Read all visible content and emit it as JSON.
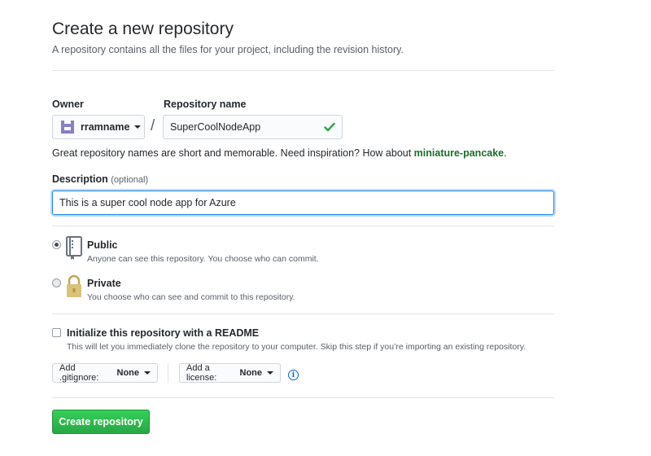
{
  "header": {
    "title": "Create a new repository",
    "subtitle": "A repository contains all the files for your project, including the revision history."
  },
  "owner": {
    "label": "Owner",
    "value": "rramname"
  },
  "repository": {
    "label": "Repository name",
    "value": "SuperCoolNodeApp",
    "separator": "/"
  },
  "hint": {
    "text": "Great repository names are short and memorable. Need inspiration? How about ",
    "suggestion": "miniature-pancake",
    "end": "."
  },
  "description": {
    "label": "Description",
    "optional": "(optional)",
    "value": "This is a super cool node app for Azure"
  },
  "visibility": {
    "public": {
      "title": "Public",
      "desc": "Anyone can see this repository. You choose who can commit.",
      "checked": true
    },
    "private": {
      "title": "Private",
      "desc": "You choose who can see and commit to this repository.",
      "checked": false
    }
  },
  "readme": {
    "title": "Initialize this repository with a README",
    "desc": "This will let you immediately clone the repository to your computer. Skip this step if you’re importing an existing repository.",
    "checked": false
  },
  "gitignore": {
    "label": "Add .gitignore:",
    "value": "None"
  },
  "license": {
    "label": "Add a license:",
    "value": "None"
  },
  "create_button": "Create repository",
  "colors": {
    "accent_green": "#28a745",
    "focus_blue": "#2188ff",
    "info_blue": "#0366d6"
  },
  "icons": {
    "owner": "identicon-avatar",
    "valid": "check-icon",
    "public": "repo-book-icon",
    "private": "lock-icon",
    "info": "info-icon"
  }
}
